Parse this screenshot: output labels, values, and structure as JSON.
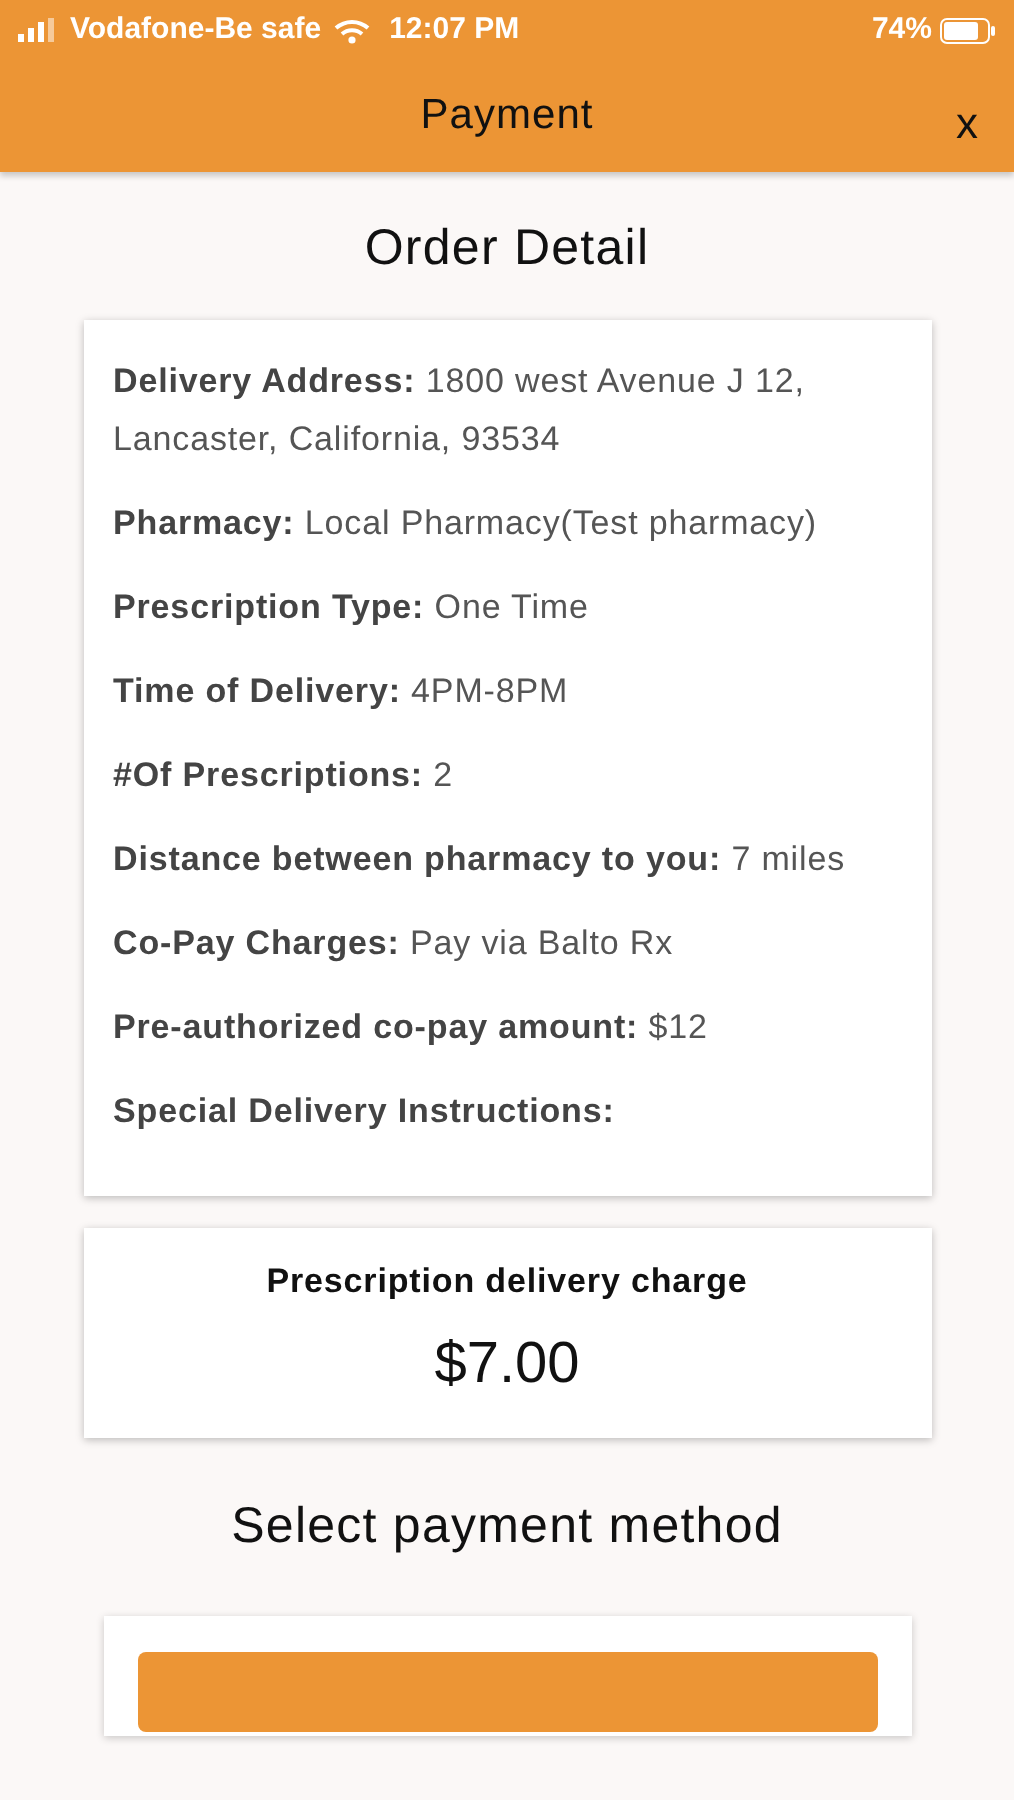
{
  "status_bar": {
    "carrier": "Vodafone-Be safe",
    "time": "12:07 PM",
    "battery": "74%"
  },
  "header": {
    "title": "Payment",
    "close": "x"
  },
  "order": {
    "title": "Order Detail",
    "rows": [
      {
        "label": "Delivery Address:",
        "value": "1800 west Avenue J 12, Lancaster, California, 93534"
      },
      {
        "label": "Pharmacy:",
        "value": "Local Pharmacy(Test pharmacy)"
      },
      {
        "label": "Prescription Type:",
        "value": "One Time"
      },
      {
        "label": "Time of Delivery:",
        "value": "4PM-8PM"
      },
      {
        "label": "#Of Prescriptions:",
        "value": "2"
      },
      {
        "label": "Distance between pharmacy to you:",
        "value": "7 miles"
      },
      {
        "label": "Co-Pay Charges:",
        "value": "Pay via Balto Rx"
      },
      {
        "label": "Pre-authorized co-pay amount:",
        "value": "$12"
      },
      {
        "label": "Special Delivery Instructions:"
      }
    ]
  },
  "charge": {
    "label": "Prescription delivery charge",
    "amount": "$7.00"
  },
  "payment": {
    "title": "Select payment method"
  }
}
